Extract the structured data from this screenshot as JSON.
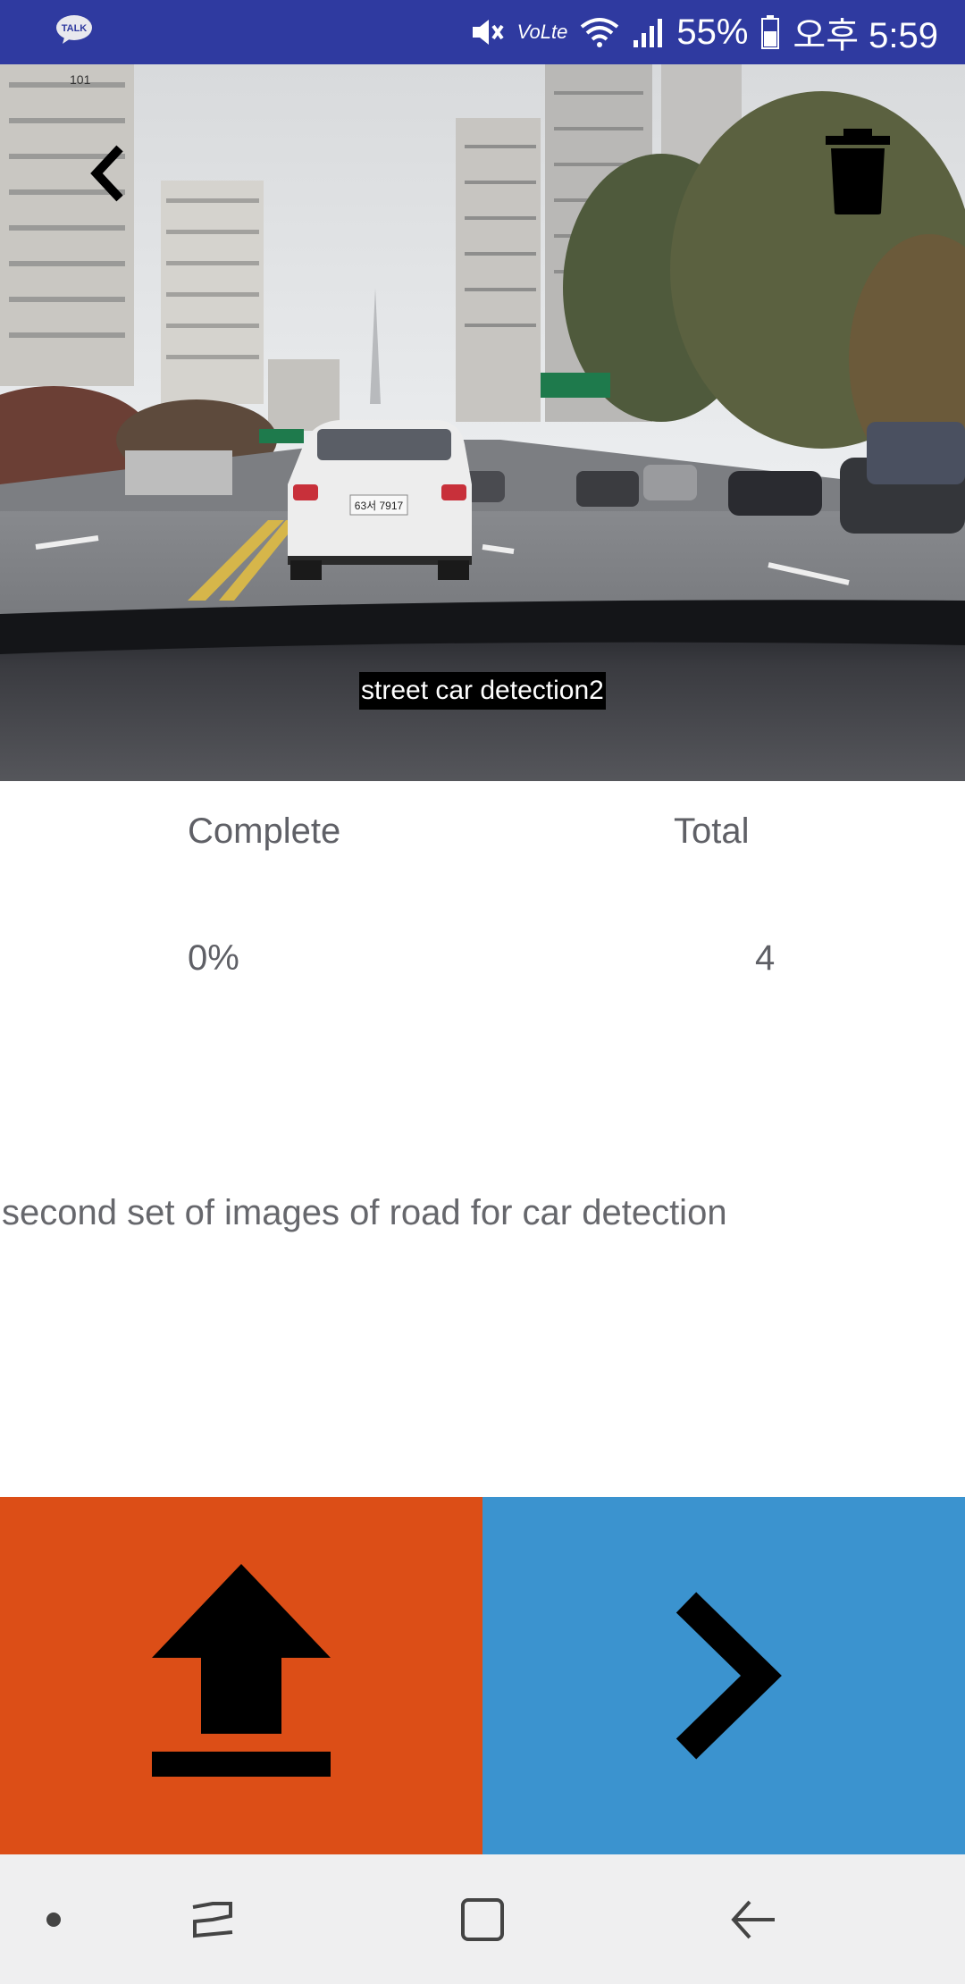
{
  "status_bar": {
    "battery": "55%",
    "time": "오후 5:59",
    "volte": "VoLte",
    "icons": [
      "talk-icon",
      "mute-icon",
      "volte-icon",
      "wifi-icon",
      "signal-icon",
      "battery-icon"
    ]
  },
  "talk_label": "TALK",
  "dataset": {
    "title": "street car detection2",
    "description": "second set of images of road for car detection"
  },
  "stats": {
    "complete_label": "Complete",
    "total_label": "Total",
    "complete_value": "0%",
    "total_value": "4"
  },
  "scene_text": {
    "plate": "63서 7917",
    "building": "101"
  },
  "colors": {
    "status_bar": "#2f3aa0",
    "upload_button": "#dc4e17",
    "next_button": "#3b93cf",
    "nav_bar": "#efeff0",
    "text_gray": "#5f6066"
  }
}
